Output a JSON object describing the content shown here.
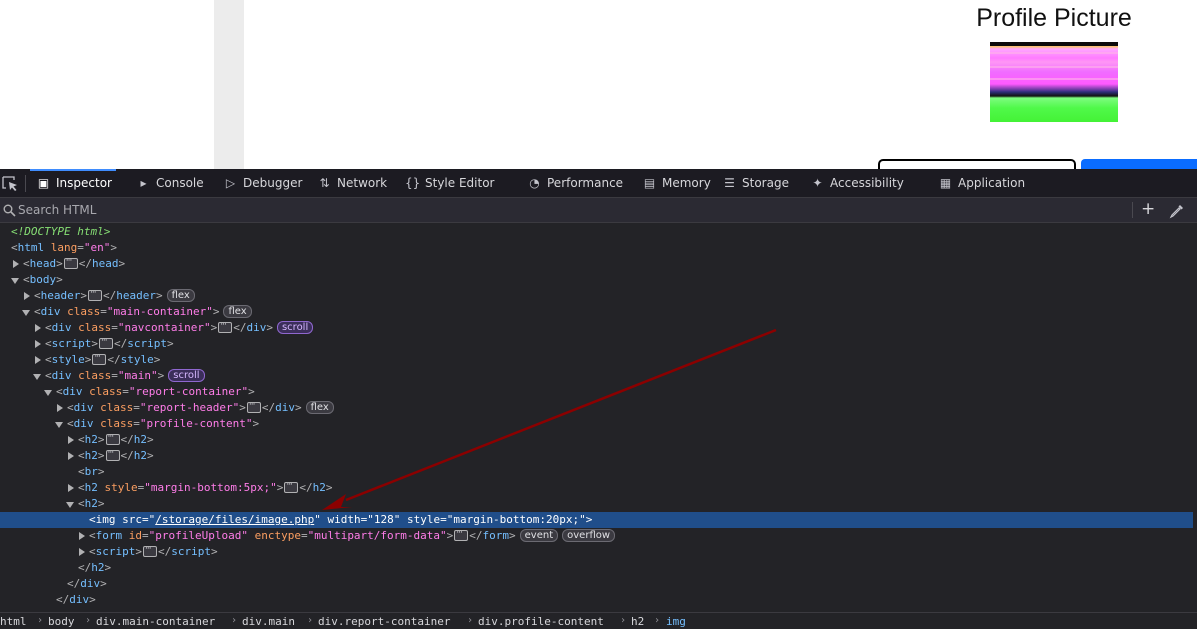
{
  "page": {
    "profile_title": "Profile Picture"
  },
  "devtools": {
    "tabs": [
      {
        "label": "Inspector",
        "icon": "inspector-icon",
        "active": true
      },
      {
        "label": "Console",
        "icon": "console-icon"
      },
      {
        "label": "Debugger",
        "icon": "debugger-icon"
      },
      {
        "label": "Network",
        "icon": "network-icon"
      },
      {
        "label": "Style Editor",
        "icon": "style-editor-icon"
      },
      {
        "label": "Performance",
        "icon": "performance-icon"
      },
      {
        "label": "Memory",
        "icon": "memory-icon"
      },
      {
        "label": "Storage",
        "icon": "storage-icon"
      },
      {
        "label": "Accessibility",
        "icon": "accessibility-icon"
      },
      {
        "label": "Application",
        "icon": "application-icon"
      }
    ],
    "search": {
      "placeholder": "Search HTML",
      "add_label": "+"
    },
    "tree": {
      "doctype": "<!DOCTYPE html>",
      "html_tag": "html",
      "html_attr": "lang",
      "html_val": "\"en\"",
      "head": "head",
      "body": "body",
      "header": "header",
      "div": "div",
      "class_attr": "class",
      "id_attr": "id",
      "src_attr": "src",
      "width_attr": "width",
      "style_attr": "style",
      "enctype_attr": "enctype",
      "main_container": "\"main-container\"",
      "navcontainer": "\"navcontainer\"",
      "script": "script",
      "style": "style",
      "main": "\"main\"",
      "report_container": "\"report-container\"",
      "report_header": "\"report-header\"",
      "profile_content": "\"profile-content\"",
      "h2": "h2",
      "br": "br",
      "h2_style": "\"margin-bottom:5px;\"",
      "img": "img",
      "img_src": "/storage/files/image.php",
      "img_width": "\"128\"",
      "img_style": "\"margin-bottom:20px;\"",
      "form": "form",
      "form_id": "\"profileUpload\"",
      "form_enctype": "\"multipart/form-data\"",
      "badges": {
        "flex": "flex",
        "scroll": "scroll",
        "event": "event",
        "overflow": "overflow"
      }
    },
    "breadcrumbs": [
      "html",
      "body",
      "div.main-container",
      "div.main",
      "div.report-container",
      "div.profile-content",
      "h2",
      "img"
    ]
  }
}
